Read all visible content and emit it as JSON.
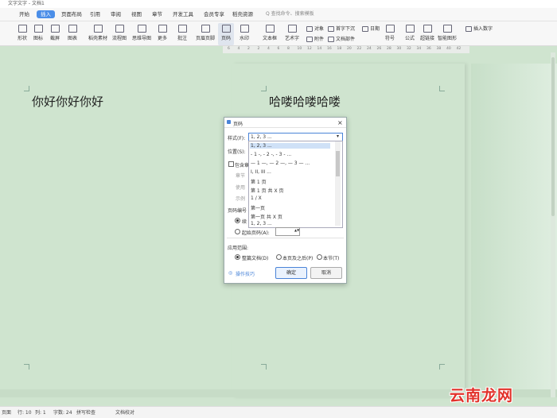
{
  "window": {
    "doc_tab": "文字文字 - 文档1"
  },
  "menu": {
    "items": [
      "开始",
      "插入",
      "页面布局",
      "引用",
      "审阅",
      "视图",
      "章节",
      "开发工具",
      "会员专享",
      "稻壳资源"
    ],
    "active_index": 1,
    "search_placeholder": "Q 查找命令、搜索模板"
  },
  "ribbon": {
    "buttons": [
      "形状",
      "图标",
      "截屏",
      "图表",
      "稻壳素材",
      "流程图",
      "思维导图",
      "更多",
      "批注",
      "页眉页脚",
      "页码",
      "水印",
      "文本框",
      "艺术字",
      "符号",
      "公式",
      "超链接",
      "智能图形"
    ],
    "small_items": [
      "对象",
      "首字下沉",
      "附件",
      "文档部件",
      "日期",
      "插入数字"
    ]
  },
  "ruler": {
    "ticks": [
      "6",
      "4",
      "2",
      "2",
      "4",
      "6",
      "8",
      "10",
      "12",
      "14",
      "16",
      "18",
      "20",
      "22",
      "24",
      "26",
      "28",
      "30",
      "32",
      "34",
      "36",
      "38",
      "40",
      "42"
    ]
  },
  "document": {
    "left_page_text": "你好你好你好",
    "right_page_text": "哈喽哈喽哈喽"
  },
  "dialog": {
    "title": "页码",
    "style_label": "样式(F):",
    "style_value": "1, 2, 3 ...",
    "position_label": "位置(S):",
    "include_chapter_label": "包含章节号",
    "chapter_style_label": "章节",
    "separator_label": "使用",
    "example_label": "示例",
    "numbering_label": "页码编号",
    "continue_label": "续",
    "start_label": "起始页码(A):",
    "start_value": "",
    "apply_label": "应用范围:",
    "apply_options": [
      "整篇文档(D)",
      "本页及之后(P)",
      "本节(T)"
    ],
    "tips_label": "操作技巧",
    "ok_label": "确定",
    "cancel_label": "取消",
    "style_options": [
      "1, 2, 3 ...",
      "- 1 -, - 2 -, - 3 - ...",
      "— 1 —, — 2 —, — 3 — ...",
      "I, II, III ...",
      "第 1 页",
      "第 1 页 共 X 页",
      "1 / X",
      "第一页",
      "第一页 共 X 页",
      "1, 2, 3 ..."
    ],
    "selected_option_index": 0
  },
  "statusbar": {
    "items": [
      "页面",
      "行: 10",
      "列: 1",
      "字数: 24",
      "拼写检查",
      "文档校对"
    ]
  },
  "watermark": "云南龙网"
}
